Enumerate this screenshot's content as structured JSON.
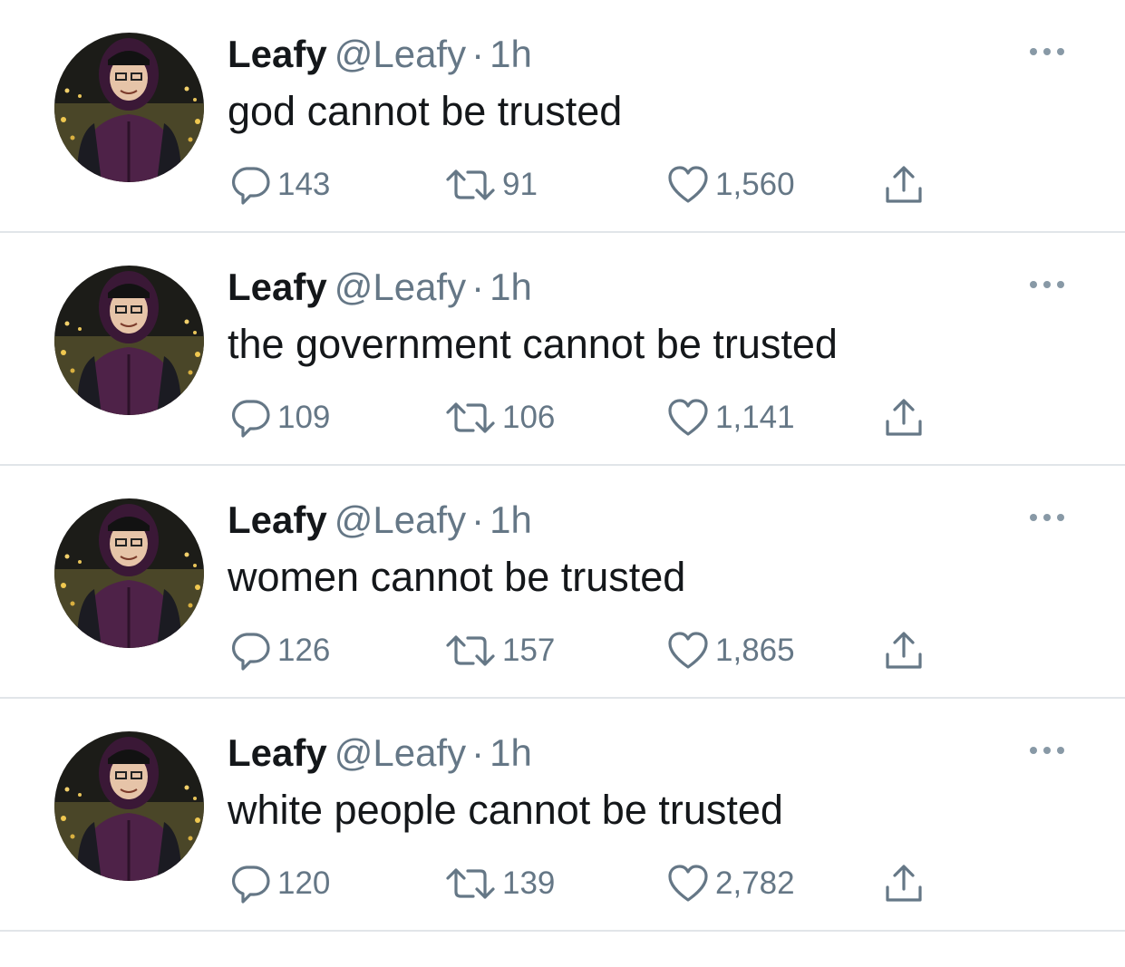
{
  "author": {
    "name": "Leafy",
    "handle": "@Leafy",
    "separator": "·",
    "avatar_icon": "profile-photo-person-in-purple-hoodie-city-night"
  },
  "colors": {
    "text_primary": "#14171a",
    "text_secondary": "#657786",
    "divider": "#e1e5e9",
    "background": "#ffffff"
  },
  "icons": {
    "reply": "speech-bubble-icon",
    "retweet": "retweet-arrows-icon",
    "like": "heart-outline-icon",
    "share": "share-upload-icon",
    "more": "ellipsis-icon"
  },
  "tweets": [
    {
      "name": "Leafy",
      "handle": "@Leafy",
      "time": "1h",
      "text": "god cannot be trusted",
      "replies": "143",
      "retweets": "91",
      "likes": "1,560"
    },
    {
      "name": "Leafy",
      "handle": "@Leafy",
      "time": "1h",
      "text": "the government cannot be trusted",
      "replies": "109",
      "retweets": "106",
      "likes": "1,141"
    },
    {
      "name": "Leafy",
      "handle": "@Leafy",
      "time": "1h",
      "text": "women cannot be trusted",
      "replies": "126",
      "retweets": "157",
      "likes": "1,865"
    },
    {
      "name": "Leafy",
      "handle": "@Leafy",
      "time": "1h",
      "text": "white people cannot be trusted",
      "replies": "120",
      "retweets": "139",
      "likes": "2,782"
    }
  ]
}
